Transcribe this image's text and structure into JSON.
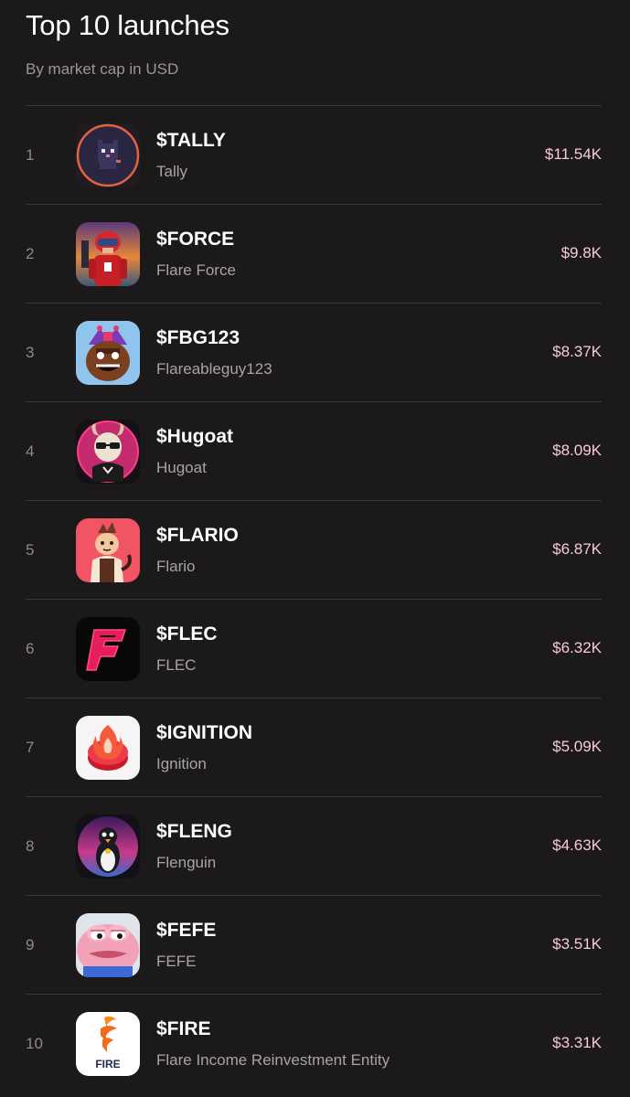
{
  "header": {
    "title": "Top 10 launches",
    "subtitle": "By market cap in USD"
  },
  "colors": {
    "background": "#1b191a",
    "divider": "#3a3738",
    "market_cap_text": "#f8c9db",
    "secondary_text": "#a8a4a6"
  },
  "launches": [
    {
      "rank": "1",
      "ticker": "$TALLY",
      "name": "Tally",
      "market_cap": "$11.54K",
      "icon": "tally-cat-logo-icon"
    },
    {
      "rank": "2",
      "ticker": "$FORCE",
      "name": "Flare Force",
      "market_cap": "$9.8K",
      "icon": "flare-force-soldier-logo-icon"
    },
    {
      "rank": "3",
      "ticker": "$FBG123",
      "name": "Flareableguy123",
      "market_cap": "$8.37K",
      "icon": "jester-creature-logo-icon"
    },
    {
      "rank": "4",
      "ticker": "$Hugoat",
      "name": "Hugoat",
      "market_cap": "$8.09K",
      "icon": "goat-with-glasses-logo-icon"
    },
    {
      "rank": "5",
      "ticker": "$FLARIO",
      "name": "Flario",
      "market_cap": "$6.87K",
      "icon": "cartoon-character-logo-icon"
    },
    {
      "rank": "6",
      "ticker": "$FLEC",
      "name": "FLEC",
      "market_cap": "$6.32K",
      "icon": "neon-f-logo-icon"
    },
    {
      "rank": "7",
      "ticker": "$IGNITION",
      "name": "Ignition",
      "market_cap": "$5.09K",
      "icon": "flame-coin-logo-icon"
    },
    {
      "rank": "8",
      "ticker": "$FLENG",
      "name": "Flenguin",
      "market_cap": "$4.63K",
      "icon": "penguin-logo-icon"
    },
    {
      "rank": "9",
      "ticker": "$FEFE",
      "name": "FEFE",
      "market_cap": "$3.51K",
      "icon": "pink-frog-logo-icon"
    },
    {
      "rank": "10",
      "ticker": "$FIRE",
      "name": "Flare Income Reinvestment Entity",
      "market_cap": "$3.31K",
      "icon": "fire-logo-icon",
      "logo_text": "FIRE"
    }
  ]
}
